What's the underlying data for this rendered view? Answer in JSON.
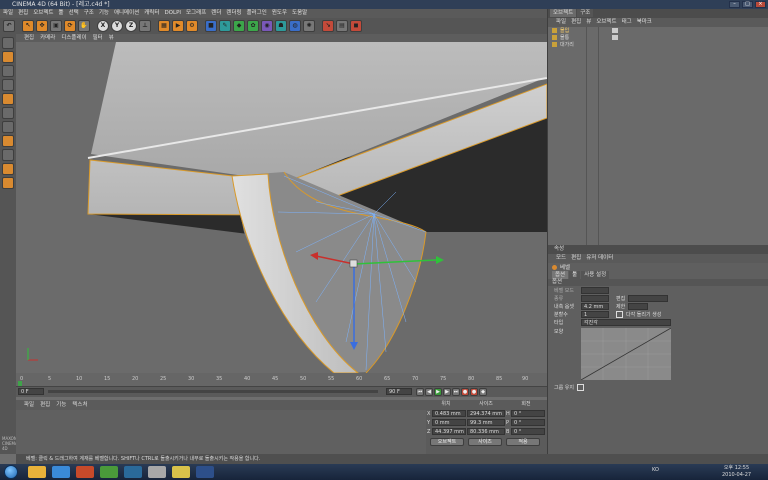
{
  "window": {
    "title": "CINEMA 4D (64 Bit) - [레고.c4d *]"
  },
  "menu": [
    "파일",
    "편집",
    "오브젝트",
    "툴",
    "선택",
    "구조",
    "기능",
    "애니메이션",
    "캐릭터",
    "DOLPI",
    "모그래프",
    "렌더",
    "렌더링",
    "플러그인",
    "윈도우",
    "도움말"
  ],
  "toolbar": {
    "icons": [
      "undo",
      "redo",
      "select",
      "move",
      "scale",
      "rotate",
      "x-axis",
      "y-axis",
      "z-axis",
      "coord",
      "render-region",
      "render",
      "render-settings",
      "cube",
      "pen",
      "subdivision",
      "cloner",
      "deformer",
      "scene",
      "camera",
      "light",
      "polygon",
      "edges",
      "object"
    ]
  },
  "left_tools": [
    "model",
    "texture",
    "object-axis",
    "point",
    "edge",
    "polygon",
    "uv",
    "snap",
    "grid",
    "workplane",
    "sculpt"
  ],
  "viewport": {
    "menu": [
      "편집",
      "카메라",
      "디스플레이",
      "필터",
      "뷰"
    ]
  },
  "timeline": {
    "ticks": [
      "0",
      "5",
      "10",
      "15",
      "20",
      "25",
      "30",
      "35",
      "40",
      "45",
      "50",
      "55",
      "60",
      "65",
      "70",
      "75",
      "80",
      "85",
      "90"
    ],
    "current_frame": "0 F",
    "end_frame": "90 F"
  },
  "materials": {
    "menu": [
      "파일",
      "편집",
      "기능",
      "텍스처"
    ]
  },
  "coords": {
    "headers": [
      "위치",
      "사이즈",
      "회전"
    ],
    "rows": [
      {
        "axis": "X",
        "pos": "0.483 mm",
        "size": "294.374 mm",
        "rot_label": "H",
        "rot": "0 °"
      },
      {
        "axis": "Y",
        "pos": "0 mm",
        "size": "99.3 mm",
        "rot_label": "P",
        "rot": "0 °"
      },
      {
        "axis": "Z",
        "pos": "44.397 mm",
        "size": "80.336 mm",
        "rot_label": "B",
        "rot": "0 °"
      }
    ],
    "mode": "오브젝트",
    "size_mode": "사이즈",
    "apply": "적용"
  },
  "objects": {
    "tabs": [
      "오브젝트",
      "구조"
    ],
    "menu": [
      "파일",
      "편집",
      "뷰",
      "오브젝트",
      "태그",
      "북마크"
    ],
    "items": [
      {
        "name": "몰입"
      },
      {
        "name": "몰통"
      },
      {
        "name": "대가리"
      }
    ]
  },
  "attributes": {
    "title": "속성",
    "menu": [
      "모드",
      "편집",
      "유저 데이터"
    ],
    "object_name": "베벨",
    "tabs": [
      "옵션",
      "툴",
      "사용 설정"
    ],
    "section": "옵션",
    "fields": [
      {
        "label": "베벨 모드",
        "value": ""
      },
      {
        "label": "종류",
        "value": ""
      },
      {
        "label": "내측 옵셋",
        "value": "4.2 mm"
      },
      {
        "label": "분할수",
        "value": "1"
      },
      {
        "label": "타입",
        "value": "각진각"
      }
    ],
    "right_labels": [
      "편집",
      "제한",
      "다각 돌리기 생성"
    ],
    "curve_label": "모양",
    "curve_footer": "그룹 유지"
  },
  "status": {
    "text": "베벨: 클릭 & 드래그하여 계재를 베벨합니다. SHIFT나 CTRL로 돌출시키거나 내부로 돌출시키는 작용을 합니다."
  },
  "taskbar": {
    "lang": "KO",
    "time": "오후 12:55",
    "date": "2010-04-27"
  },
  "brand": {
    "line1": "MAXON",
    "line2": "CINEMA 4D"
  }
}
